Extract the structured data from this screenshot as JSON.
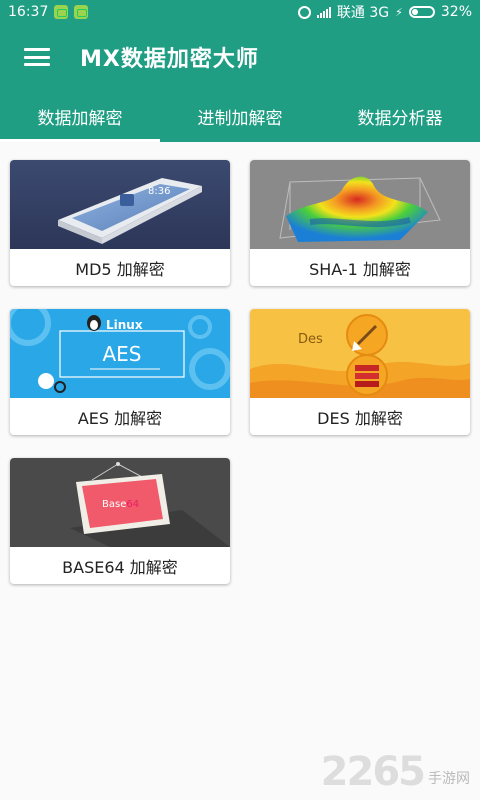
{
  "statusbar": {
    "time": "16:37",
    "carrier": "联通 3G",
    "battery": "32%",
    "battery_level": 0.32
  },
  "appbar": {
    "title": "MX数据加密大师"
  },
  "tabs": [
    {
      "label": "数据加解密",
      "active": true
    },
    {
      "label": "进制加解密",
      "active": false
    },
    {
      "label": "数据分析器",
      "active": false
    }
  ],
  "cards": [
    {
      "label": "MD5 加解密",
      "image_icon": "phone-image-icon",
      "image_text": "8:36"
    },
    {
      "label": "SHA-1 加解密",
      "image_icon": "surface-plot-icon"
    },
    {
      "label": "AES 加解密",
      "image_icon": "linux-aes-icon",
      "image_title": "AES",
      "image_brand": "Linux"
    },
    {
      "label": "DES 加解密",
      "image_icon": "des-icon",
      "image_text": "Des"
    },
    {
      "label": "BASE64 加解密",
      "image_icon": "base64-frame-icon",
      "image_text": "Base",
      "image_text_accent": "64"
    }
  ],
  "watermark": {
    "number": "2265",
    "text": "手游网"
  },
  "colors": {
    "primary": "#1f9e84",
    "background": "#fafafa"
  }
}
